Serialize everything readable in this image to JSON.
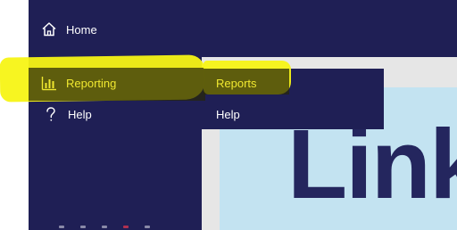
{
  "nav": {
    "home_label": "Home",
    "reporting_label": "Reporting",
    "help_label": "Help"
  },
  "submenu": {
    "reports_label": "Reports",
    "help_label": "Help"
  },
  "content": {
    "brand_text": "Link"
  },
  "icons": {
    "home": "home-icon",
    "reporting": "bar-chart-icon",
    "help": "question-icon"
  },
  "colors": {
    "nav_bg": "#1f1f55",
    "highlight": "#f7f415",
    "active_text": "#f0e830",
    "content_panel": "#c3e3f1",
    "brand": "#24265e"
  }
}
